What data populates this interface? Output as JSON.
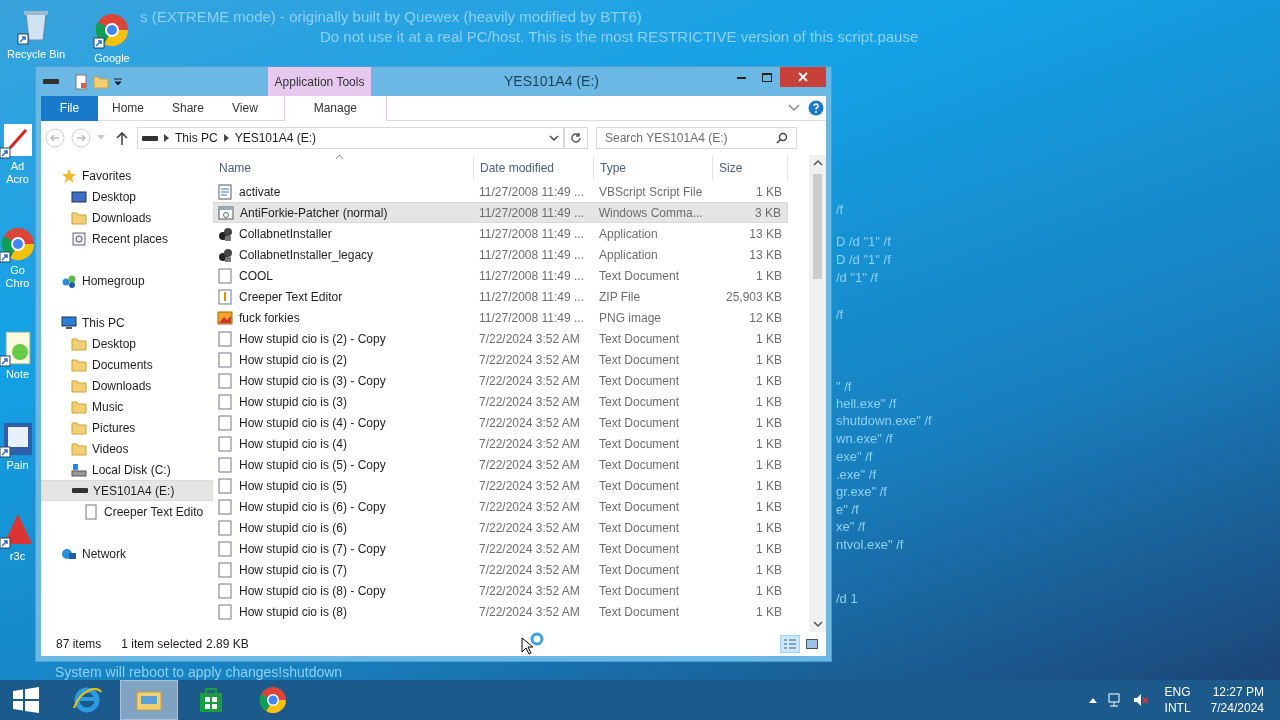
{
  "desktop": {
    "background_text": [
      "s (EXTREME mode) - originally built by Quewex (heavily modified by BTT6)",
      "Do not use it at a real PC/host. This is the most RESTRICTIVE version of this script.pause",
      "/f",
      "D /d \"1\" /f",
      "D /d \"1\" /f",
      "/d \"1\" /f",
      "/f",
      "\" /f",
      "hell.exe\" /f",
      "shutdown.exe\" /f",
      "wn.exe\" /f",
      "exe\" /f",
      ".exe\" /f",
      "gr.exe\" /f",
      "e\" /f",
      "xe\" /f",
      "ntvol.exe\" /f",
      "/d 1",
      "System will reboot to apply changes!shutdown"
    ],
    "icons": [
      {
        "kind": "recycle",
        "label": "Recycle Bin"
      },
      {
        "kind": "chrome",
        "label": "Google"
      },
      {
        "kind": "acrobat",
        "label": "Ad Acro"
      },
      {
        "kind": "chrome",
        "label": "Go Chro"
      },
      {
        "kind": "notepad",
        "label": "Note"
      },
      {
        "kind": "paint",
        "label": "Pain"
      },
      {
        "kind": "r3",
        "label": "r3c"
      }
    ]
  },
  "window": {
    "title": "YES101A4 (E:)",
    "contextual_group": "Application Tools",
    "ribbon_tabs": [
      {
        "label": "File",
        "kind": "file",
        "selected": false
      },
      {
        "label": "Home",
        "kind": "tab",
        "selected": false
      },
      {
        "label": "Share",
        "kind": "tab",
        "selected": false
      },
      {
        "label": "View",
        "kind": "tab",
        "selected": false
      },
      {
        "label": "Manage",
        "kind": "contextual",
        "selected": false
      }
    ],
    "address": {
      "crumbs": [
        "This PC",
        "YES101A4 (E:)"
      ]
    },
    "search": {
      "placeholder": "Search YES101A4 (E:)"
    },
    "nav": [
      {
        "label": "Favorites",
        "kind": "star",
        "selected": false,
        "children": [
          {
            "label": "Desktop",
            "kind": "desktop",
            "selected": false
          },
          {
            "label": "Downloads",
            "kind": "folder",
            "selected": false
          },
          {
            "label": "Recent places",
            "kind": "recent",
            "selected": false
          }
        ]
      },
      {
        "label": "Homegroup",
        "kind": "homegroup",
        "selected": false
      },
      {
        "label": "This PC",
        "kind": "pc",
        "selected": false,
        "children": [
          {
            "label": "Desktop",
            "kind": "folder",
            "selected": false
          },
          {
            "label": "Documents",
            "kind": "folder",
            "selected": false
          },
          {
            "label": "Downloads",
            "kind": "folder",
            "selected": false
          },
          {
            "label": "Music",
            "kind": "folder",
            "selected": false
          },
          {
            "label": "Pictures",
            "kind": "folder",
            "selected": false
          },
          {
            "label": "Videos",
            "kind": "folder",
            "selected": false
          },
          {
            "label": "Local Disk (C:)",
            "kind": "disk",
            "selected": false
          },
          {
            "label": "YES101A4 (E:)",
            "kind": "drive",
            "selected": true,
            "children": [
              {
                "label": "Creeper Text Edito",
                "kind": "file",
                "selected": false
              }
            ]
          }
        ]
      },
      {
        "label": "Network",
        "kind": "network",
        "selected": false
      }
    ],
    "columns": [
      "Name",
      "Date modified",
      "Type",
      "Size"
    ],
    "rows": [
      {
        "kind": "script",
        "name": "activate",
        "date": "11/27/2008 11:49 ...",
        "type": "VBScript Script File",
        "size": "1 KB",
        "selected": false
      },
      {
        "kind": "batch",
        "name": "AntiForkie-Patcher (normal)",
        "date": "11/27/2008 11:49 ...",
        "type": "Windows Comma...",
        "size": "3 KB",
        "selected": true
      },
      {
        "kind": "app",
        "name": "CollabnetInstaller",
        "date": "11/27/2008 11:49 ...",
        "type": "Application",
        "size": "13 KB",
        "selected": false
      },
      {
        "kind": "app",
        "name": "CollabnetInstaller_legacy",
        "date": "11/27/2008 11:49 ...",
        "type": "Application",
        "size": "13 KB",
        "selected": false
      },
      {
        "kind": "text",
        "name": "COOL",
        "date": "11/27/2008 11:49 ...",
        "type": "Text Document",
        "size": "1 KB",
        "selected": false
      },
      {
        "kind": "zip",
        "name": "Creeper Text Editor",
        "date": "11/27/2008 11:49 ...",
        "type": "ZIP File",
        "size": "25,903 KB",
        "selected": false
      },
      {
        "kind": "image",
        "name": "fuck forkies",
        "date": "11/27/2008 11:49 ...",
        "type": "PNG image",
        "size": "12 KB",
        "selected": false
      },
      {
        "kind": "text",
        "name": "How stupid cio is (2) - Copy",
        "date": "7/22/2024 3:52 AM",
        "type": "Text Document",
        "size": "1 KB",
        "selected": false
      },
      {
        "kind": "text",
        "name": "How stupid cio is (2)",
        "date": "7/22/2024 3:52 AM",
        "type": "Text Document",
        "size": "1 KB",
        "selected": false
      },
      {
        "kind": "text",
        "name": "How stupid cio is (3) - Copy",
        "date": "7/22/2024 3:52 AM",
        "type": "Text Document",
        "size": "1 KB",
        "selected": false
      },
      {
        "kind": "text",
        "name": "How stupid cio is (3)",
        "date": "7/22/2024 3:52 AM",
        "type": "Text Document",
        "size": "1 KB",
        "selected": false
      },
      {
        "kind": "text",
        "name": "How stupid cio is (4) - Copy",
        "date": "7/22/2024 3:52 AM",
        "type": "Text Document",
        "size": "1 KB",
        "selected": false
      },
      {
        "kind": "text",
        "name": "How stupid cio is (4)",
        "date": "7/22/2024 3:52 AM",
        "type": "Text Document",
        "size": "1 KB",
        "selected": false
      },
      {
        "kind": "text",
        "name": "How stupid cio is (5) - Copy",
        "date": "7/22/2024 3:52 AM",
        "type": "Text Document",
        "size": "1 KB",
        "selected": false
      },
      {
        "kind": "text",
        "name": "How stupid cio is (5)",
        "date": "7/22/2024 3:52 AM",
        "type": "Text Document",
        "size": "1 KB",
        "selected": false
      },
      {
        "kind": "text",
        "name": "How stupid cio is (6) - Copy",
        "date": "7/22/2024 3:52 AM",
        "type": "Text Document",
        "size": "1 KB",
        "selected": false
      },
      {
        "kind": "text",
        "name": "How stupid cio is (6)",
        "date": "7/22/2024 3:52 AM",
        "type": "Text Document",
        "size": "1 KB",
        "selected": false
      },
      {
        "kind": "text",
        "name": "How stupid cio is (7) - Copy",
        "date": "7/22/2024 3:52 AM",
        "type": "Text Document",
        "size": "1 KB",
        "selected": false
      },
      {
        "kind": "text",
        "name": "How stupid cio is (7)",
        "date": "7/22/2024 3:52 AM",
        "type": "Text Document",
        "size": "1 KB",
        "selected": false
      },
      {
        "kind": "text",
        "name": "How stupid cio is (8) - Copy",
        "date": "7/22/2024 3:52 AM",
        "type": "Text Document",
        "size": "1 KB",
        "selected": false
      },
      {
        "kind": "text",
        "name": "How stupid cio is (8)",
        "date": "7/22/2024 3:52 AM",
        "type": "Text Document",
        "size": "1 KB",
        "selected": false
      }
    ],
    "status": {
      "count": "87 items",
      "selection": "1 item selected",
      "selection_size": "2.89 KB"
    },
    "views": [
      {
        "kind": "details",
        "selected": true
      },
      {
        "kind": "tiles",
        "selected": false
      }
    ]
  },
  "taskbar": {
    "apps": [
      {
        "kind": "ie",
        "selected": false
      },
      {
        "kind": "explorer",
        "selected": true
      },
      {
        "kind": "store",
        "selected": false
      },
      {
        "kind": "chrome",
        "selected": false
      }
    ],
    "language": [
      "ENG",
      "INTL"
    ],
    "time": "12:27 PM",
    "date": "7/24/2024"
  }
}
